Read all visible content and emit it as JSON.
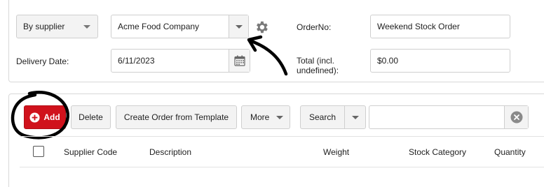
{
  "filters": {
    "mode_select": "By supplier",
    "supplier_value": "Acme Food Company",
    "order_no_label": "OrderNo:",
    "order_no_value": "Weekend Stock Order",
    "delivery_date_label": "Delivery Date:",
    "delivery_date_value": "6/11/2023",
    "total_label_line1": "Total (incl.",
    "total_label_line2": "undefined):",
    "total_value": "$0.00"
  },
  "toolbar": {
    "add_label": "Add",
    "delete_label": "Delete",
    "template_label": "Create Order from Template",
    "more_label": "More",
    "search_select_label": "Search",
    "search_value": ""
  },
  "grid": {
    "columns": [
      "Supplier Code",
      "Description",
      "Weight",
      "Stock Category",
      "Quantity"
    ]
  },
  "colors": {
    "accent": "#d0121c",
    "annotation": "#000000"
  },
  "icons": {
    "settings": "gear-icon",
    "calendar": "calendar-icon",
    "add": "plus-circle-icon",
    "clear": "clear-x-icon"
  }
}
